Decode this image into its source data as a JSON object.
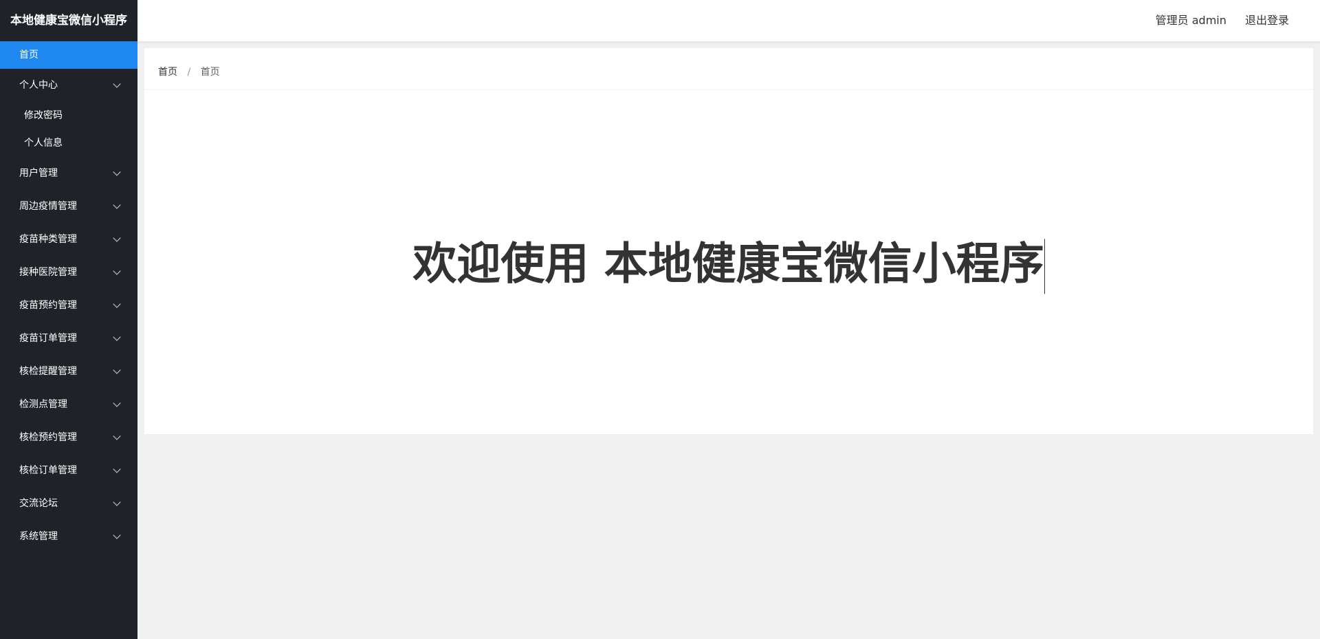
{
  "sidebar": {
    "brand": "本地健康宝微信小程序",
    "home": "首页",
    "personal_center": {
      "label": "个人中心",
      "children": [
        "修改密码",
        "个人信息"
      ]
    },
    "items": [
      "用户管理",
      "周边疫情管理",
      "疫苗种类管理",
      "接种医院管理",
      "疫苗预约管理",
      "疫苗订单管理",
      "核检提醒管理",
      "检测点管理",
      "核检预约管理",
      "核检订单管理",
      "交流论坛",
      "系统管理"
    ]
  },
  "header": {
    "user": "管理员 admin",
    "logout": "退出登录"
  },
  "breadcrumb": {
    "root": "首页",
    "separator": "/",
    "current": "首页"
  },
  "main": {
    "welcome": "欢迎使用 本地健康宝微信小程序"
  },
  "colors": {
    "sidebar_bg": "#20222a",
    "active_item": "#1e88f0",
    "page_bg": "#f0f0f0"
  }
}
